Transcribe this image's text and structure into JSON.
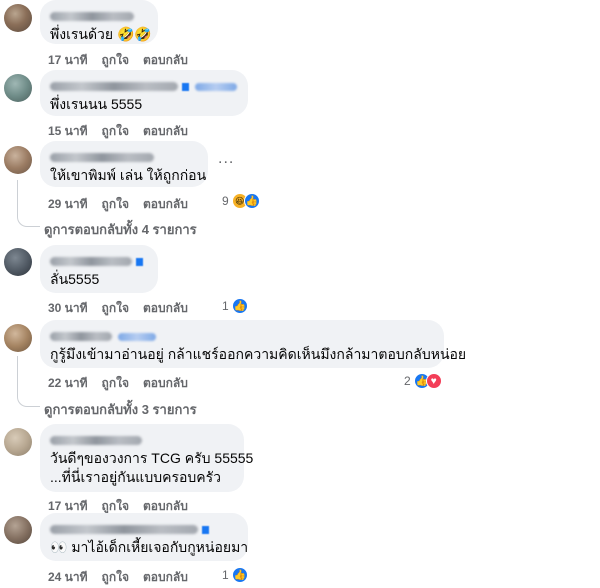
{
  "comments": [
    {
      "text": "พึ่งเรนด้วย 🤣🤣",
      "time": "17 นาที",
      "like_label": "ถูกใจ",
      "reply_label": "ตอบกลับ"
    },
    {
      "text": "พึ่งเรนนน 5555",
      "time": "15 นาที",
      "like_label": "ถูกใจ",
      "reply_label": "ตอบกลับ"
    },
    {
      "text": "ให้เขาพิมพ์ เล่น ให้ถูกก่อน",
      "time": "29 นาที",
      "like_label": "ถูกใจ",
      "reply_label": "ตอบกลับ",
      "reaction_count": "9",
      "replies_link": "ดูการตอบกลับทั้ง 4 รายการ"
    },
    {
      "text": "ลั่น5555",
      "time": "30 นาที",
      "like_label": "ถูกใจ",
      "reply_label": "ตอบกลับ",
      "reaction_count": "1"
    },
    {
      "text": "กูรู้มึงเข้ามาอ่านอยู่ กล้าแชร์ออกความคิดเห็นมึงกล้ามาตอบกลับหน่อย",
      "time": "22 นาที",
      "like_label": "ถูกใจ",
      "reply_label": "ตอบกลับ",
      "reaction_count": "2",
      "replies_link": "ดูการตอบกลับทั้ง 3 รายการ"
    },
    {
      "text_line1": "วันดีๆของวงการ TCG ครับ 55555",
      "text_line2": "...ที่นี่เราอยู่กันแบบครอบครัว",
      "time": "17 นาที",
      "like_label": "ถูกใจ",
      "reply_label": "ตอบกลับ"
    },
    {
      "text": "👀 มาไอ้เด็กเหี้ยเจอกับกูหน่อยมา",
      "time": "24 นาที",
      "like_label": "ถูกใจ",
      "reply_label": "ตอบกลับ",
      "reaction_count": "1"
    }
  ],
  "more_options": "...",
  "colors": {
    "bubble": "#f0f2f5",
    "meta": "#65676b",
    "like": "#1877f2",
    "love": "#f33e58"
  }
}
